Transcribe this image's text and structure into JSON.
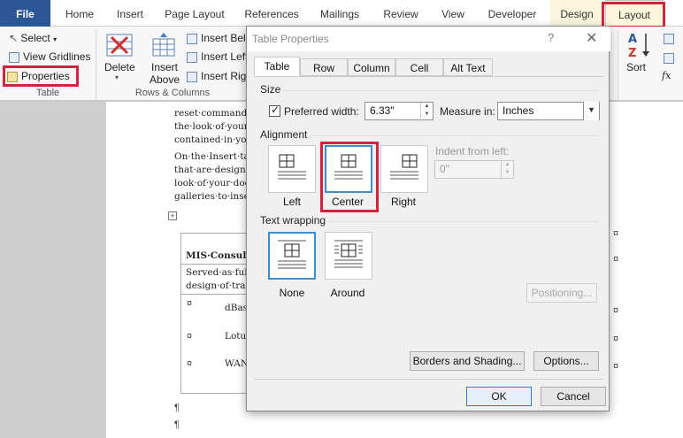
{
  "ribbon_tabs": [
    "File",
    "Home",
    "Insert",
    "Page Layout",
    "References",
    "Mailings",
    "Review",
    "View",
    "Developer",
    "Design",
    "Layout"
  ],
  "ribbon": {
    "select": "Select",
    "view_gridlines": "View Gridlines",
    "properties": "Properties",
    "group_table": "Table",
    "delete": "Delete",
    "insert_above": "Insert Above",
    "insert_below": "Insert Belo",
    "insert_left": "Insert Left",
    "insert_right": "Insert Righ",
    "group_rows_columns": "Rows & Columns",
    "sort": "Sort"
  },
  "document": {
    "lines": [
      "reset·commands",
      "the·look·of·your·c",
      "contained·in·your",
      "On·the·Insert·tab",
      "that·are·designed",
      "look·of·your·docu",
      "galleries·to·insert"
    ],
    "heading": "MIS·Consult",
    "body_lines": [
      "Served·as·full",
      "design·of·trai"
    ],
    "bullets": [
      "dBas",
      "Lotu",
      "WAN"
    ]
  },
  "dialog": {
    "title": "Table Properties",
    "help": "?",
    "close": "✕",
    "tabs": [
      "Table",
      "Row",
      "Column",
      "Cell",
      "Alt Text"
    ],
    "size_label": "Size",
    "preferred_width_label": "Preferred width:",
    "preferred_width_value": "6.33\"",
    "measure_in_label": "Measure in:",
    "measure_in_value": "Inches",
    "alignment_label": "Alignment",
    "alignment_options": [
      "Left",
      "Center",
      "Right"
    ],
    "indent_label": "Indent from left:",
    "indent_value": "0\"",
    "text_wrapping_label": "Text wrapping",
    "wrapping_options": [
      "None",
      "Around"
    ],
    "positioning_button": "Positioning...",
    "borders_button": "Borders and Shading...",
    "options_button": "Options...",
    "ok_button": "OK",
    "cancel_button": "Cancel"
  },
  "colors": {
    "highlight": "#d4213d",
    "selected": "#3b8ed0",
    "file_tab": "#2b5797"
  }
}
